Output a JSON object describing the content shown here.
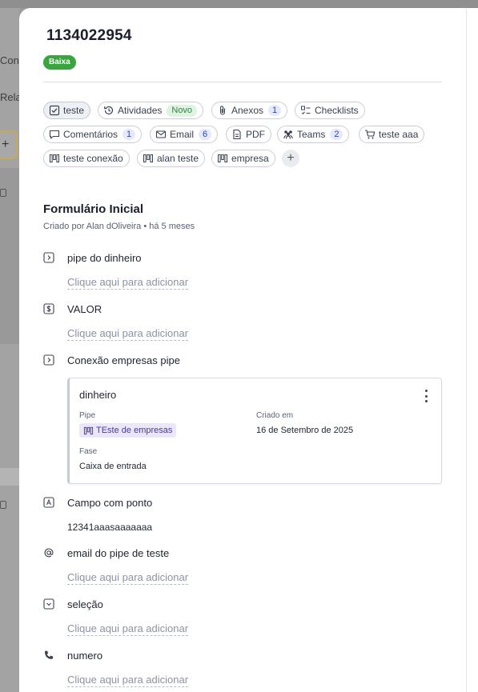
{
  "background": {
    "fragments": [
      "Cone",
      "Rela"
    ]
  },
  "card": {
    "title": "1134022954",
    "priority": "Baixa"
  },
  "chips": [
    {
      "label": "teste",
      "icon": "checkbox-icon"
    },
    {
      "label": "Atividades",
      "icon": "history-icon",
      "badge": "Novo"
    },
    {
      "label": "Anexos",
      "icon": "paperclip-icon",
      "count": "1"
    },
    {
      "label": "Checklists",
      "icon": "checklist-icon"
    },
    {
      "label": "Comentários",
      "icon": "comment-icon",
      "count": "1"
    },
    {
      "label": "Email",
      "icon": "email-icon",
      "count": "6"
    },
    {
      "label": "PDF",
      "icon": "pdf-icon"
    },
    {
      "label": "Teams",
      "icon": "teams-icon",
      "count": "2"
    },
    {
      "label": "teste aaa",
      "icon": "cart-icon"
    },
    {
      "label": "teste conexão",
      "icon": "pipe-icon"
    },
    {
      "label": "alan teste",
      "icon": "pipe-icon"
    },
    {
      "label": "empresa",
      "icon": "pipe-icon"
    }
  ],
  "form": {
    "title": "Formulário Inicial",
    "meta": "Criado por Alan dOliveira • há 5 meses",
    "add_placeholder": "Clique aqui para adicionar",
    "fields": [
      {
        "label": "pipe do dinheiro",
        "icon": "connection-icon"
      },
      {
        "label": "VALOR",
        "icon": "currency-icon"
      },
      {
        "label": "Conexão empresas pipe",
        "icon": "connection-icon"
      },
      {
        "label": "Campo com ponto",
        "icon": "text-field-icon",
        "value": "12341aaasaaaaaaa"
      },
      {
        "label": "email do pipe de teste",
        "icon": "at-icon"
      },
      {
        "label": "seleção",
        "icon": "select-icon"
      },
      {
        "label": "numero",
        "icon": "phone-icon"
      }
    ]
  },
  "connection": {
    "title": "dinheiro",
    "pipe_label": "Pipe",
    "pipe_value": "TEste de empresas",
    "created_label": "Criado em",
    "created_value": "16 de Setembro de 2025",
    "phase_label": "Fase",
    "phase_value": "Caixa de entrada"
  },
  "colors": {
    "priority": "#3aa43f",
    "count_badge": "#2c46b8",
    "novo_badge": "#2d8a3e",
    "pipe_tag_bg": "#ece6fa"
  }
}
